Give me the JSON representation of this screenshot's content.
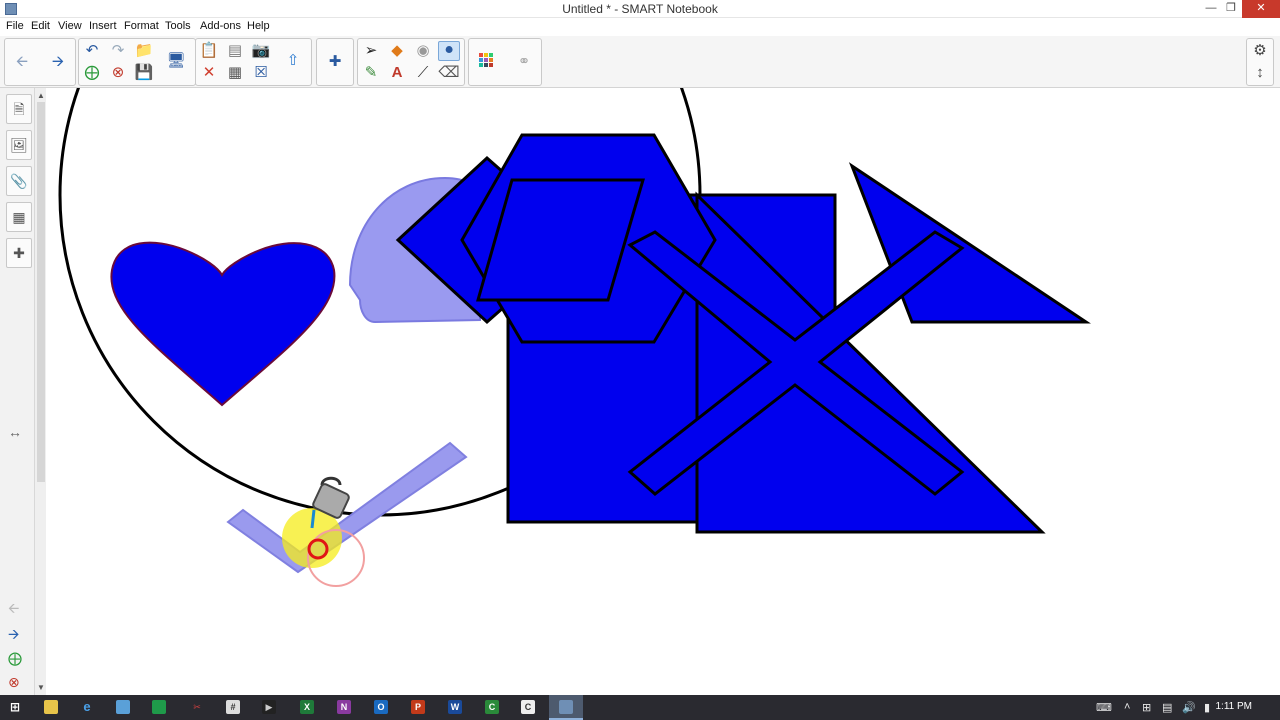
{
  "window": {
    "title": "Untitled * - SMART Notebook"
  },
  "menu": {
    "items": [
      "File",
      "Edit",
      "View",
      "Insert",
      "Format",
      "Tools",
      "Add-ons",
      "Help"
    ]
  },
  "toolbar": {
    "nav": [
      "back-arrow-icon",
      "forward-arrow-icon"
    ],
    "file_group": [
      "undo-icon",
      "redo-icon",
      "open-folder-icon",
      "add-page-icon",
      "delete-page-icon",
      "save-icon",
      "display-screen-icon"
    ],
    "edit_group": [
      "paste-icon",
      "delete-icon",
      "screen-shade-icon",
      "table-icon",
      "full-screen-icon",
      "capture-icon",
      "tools-icon",
      "add-on-icon"
    ],
    "draw_group": [
      "select-icon",
      "shapes-icon",
      "eraser-fill-icon",
      "fill-icon",
      "pens-icon",
      "text-icon",
      "line-icon",
      "eraser-icon"
    ],
    "properties": [
      "color-palette-icon",
      "magic-pen-icon"
    ],
    "settings": [
      "gear-icon",
      "toolbar-move-icon"
    ]
  },
  "sidebar": {
    "tabs": [
      "page-sorter-icon",
      "gallery-icon",
      "attachments-icon",
      "properties-icon",
      "add-ons-icon"
    ]
  },
  "canvas": {
    "shape_fill": "#0000ee",
    "translucent_fill": "#8f8fee",
    "heart_stroke": "#6a0a3a"
  },
  "taskbar": {
    "apps": [
      "start-icon",
      "file-explorer-icon",
      "ie-icon",
      "remote-desktop-icon",
      "excel-alt-icon",
      "snip-icon",
      "calculator-icon",
      "media-icon",
      "excel-icon",
      "onenote-icon",
      "outlook-icon",
      "powerpoint-icon",
      "word-icon",
      "camtasia-icon",
      "camtasia-recorder-icon",
      "smart-notebook-icon"
    ],
    "time": "1:11 PM"
  }
}
